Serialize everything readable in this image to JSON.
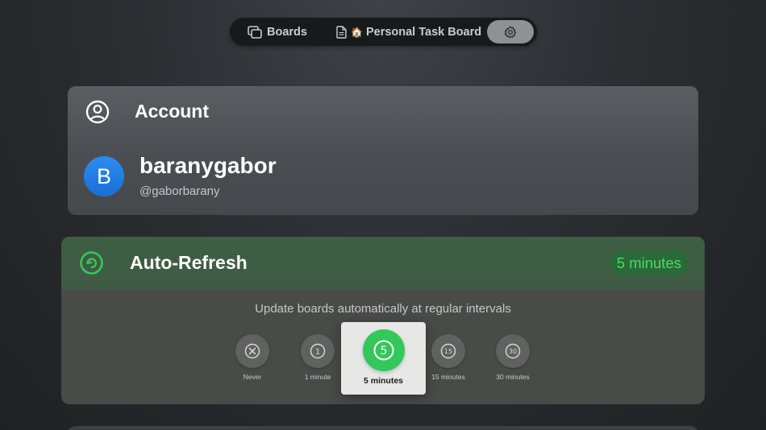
{
  "nav": {
    "boards_label": "Boards",
    "board_label": "Personal Task Board",
    "board_emoji": "🏠",
    "settings_icon": "gear-icon"
  },
  "account": {
    "title": "Account",
    "avatar_initial": "B",
    "username": "baranygabor",
    "handle": "@gaborbarany",
    "avatar_color": "#1a7ae8"
  },
  "auto_refresh": {
    "title": "Auto-Refresh",
    "current_value": "5 minutes",
    "description": "Update boards automatically at regular intervals",
    "accent_color": "#34c759",
    "options": [
      {
        "label": "Never",
        "icon": "x-circle-icon"
      },
      {
        "label": "1 minute",
        "icon": "1",
        "selected": false
      },
      {
        "label": "5 minutes",
        "icon": "5",
        "selected": true
      },
      {
        "label": "15 minutes",
        "icon": "15",
        "selected": false
      },
      {
        "label": "30 minutes",
        "icon": "30",
        "selected": false
      }
    ]
  }
}
